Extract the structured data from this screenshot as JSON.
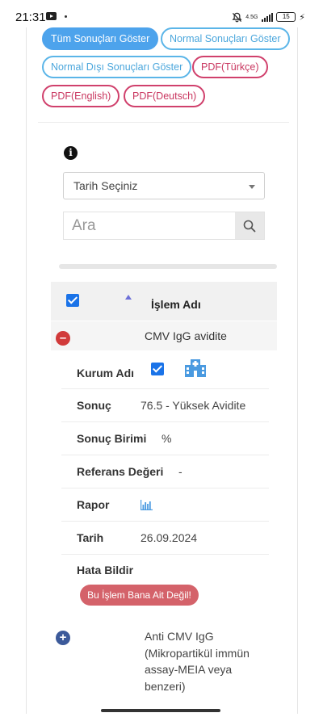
{
  "status_bar": {
    "time": "21:31",
    "network": "4.5G",
    "battery": "15"
  },
  "filters": {
    "all_results": "Tüm Sonuçları Göster",
    "normal_results": "Normal Sonuçları Göster",
    "abnormal_results": "Normal Dışı Sonuçları Göster",
    "pdf_tr": "PDF(Türkçe)",
    "pdf_en": "PDF(English)",
    "pdf_de": "PDF(Deutsch)"
  },
  "date_select": {
    "selected": "Tarih Seçiniz"
  },
  "search": {
    "placeholder": "Ara"
  },
  "table": {
    "header": "İşlem Adı",
    "rows": [
      {
        "title": "CMV IgG avidite",
        "expanded": true,
        "details": {
          "institution_label": "Kurum Adı",
          "result_label": "Sonuç",
          "result_value": "76.5 - Yüksek Avidite",
          "unit_label": "Sonuç Birimi",
          "unit_value": "%",
          "reference_label": "Referans Değeri",
          "reference_value": "-",
          "report_label": "Rapor",
          "date_label": "Tarih",
          "date_value": "26.09.2024",
          "report_error_label": "Hata Bildir",
          "report_error_button": "Bu İşlem Bana Ait Değil!"
        }
      },
      {
        "title": "Anti CMV IgG (Mikropartikül immün assay-MEIA veya benzeri)",
        "expanded": false
      }
    ]
  },
  "colors": {
    "primary_blue": "#4da3ec",
    "pdf_red": "#d0406c",
    "error_button": "#d4626a",
    "collapse_red": "#d13a3a",
    "expand_blue": "#3c5a9a"
  }
}
